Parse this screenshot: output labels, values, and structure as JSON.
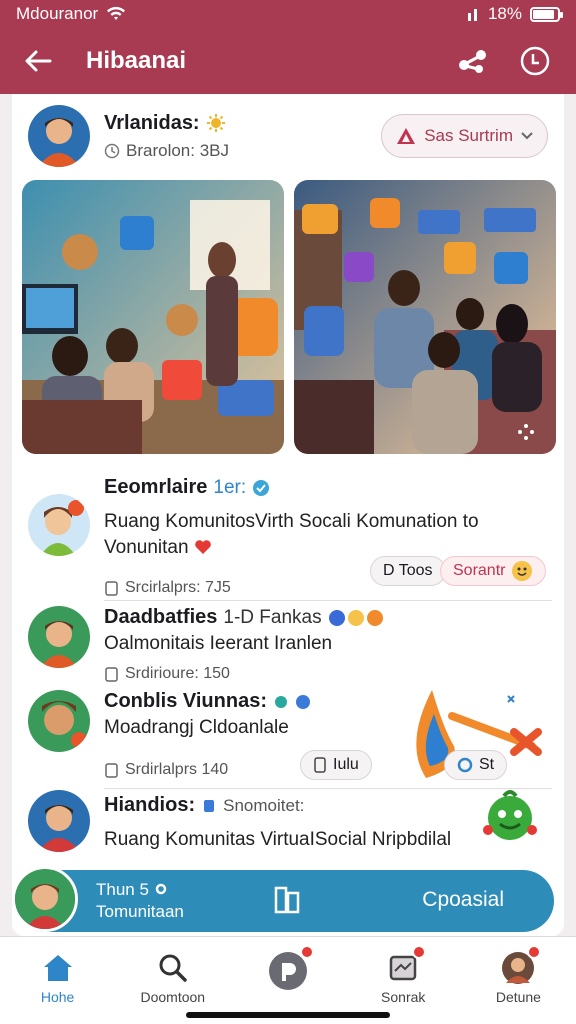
{
  "status_bar": {
    "carrier": "Mdouranor",
    "battery_text": "18%",
    "battery_level": 0.8
  },
  "app_bar": {
    "title": "Hibaanai"
  },
  "post": {
    "author": "Vrlanidas:",
    "sub": "Brarolon: 3BJ",
    "subscribe_label": "Sas Surtrim"
  },
  "feed": [
    {
      "title": "Eeomrlaire",
      "tag": "1er:",
      "text": "Ruang KomunitosVirth Socali Komunation to Vonunitan",
      "meta": "Srcirlalprs: 7J5",
      "chip1": "D Toos",
      "chip2": "Sorantr"
    },
    {
      "title": "Daadbatfies",
      "tag": "1-D Fankas",
      "text": "Oalmonitais Ieerant Iranlen",
      "meta": "Srdirioure: 150"
    },
    {
      "title": "Conblis Viunnas:",
      "text": "Moadrangj Cldoanlale",
      "meta": "Srdirlalprs 140",
      "chip1": "Iulu",
      "chip2": "St"
    },
    {
      "title": "Hiandios:",
      "tag": "Snomoitet:",
      "text": "Ruang Komunitas VirtuaISocial Nripbdilal"
    }
  ],
  "banner": {
    "line1": "Thun 5",
    "line2": "Tomunitaan",
    "cta": "Cpoasial"
  },
  "bottom_nav": [
    {
      "label": "Hohe",
      "active": true
    },
    {
      "label": "Doomtoon",
      "active": false
    },
    {
      "label": "",
      "active": false
    },
    {
      "label": "Sonrak",
      "active": false
    },
    {
      "label": "Detune",
      "active": false
    }
  ],
  "colors": {
    "primary": "#a83a52",
    "accent": "#2e86c8",
    "banner": "#2e8db8"
  }
}
